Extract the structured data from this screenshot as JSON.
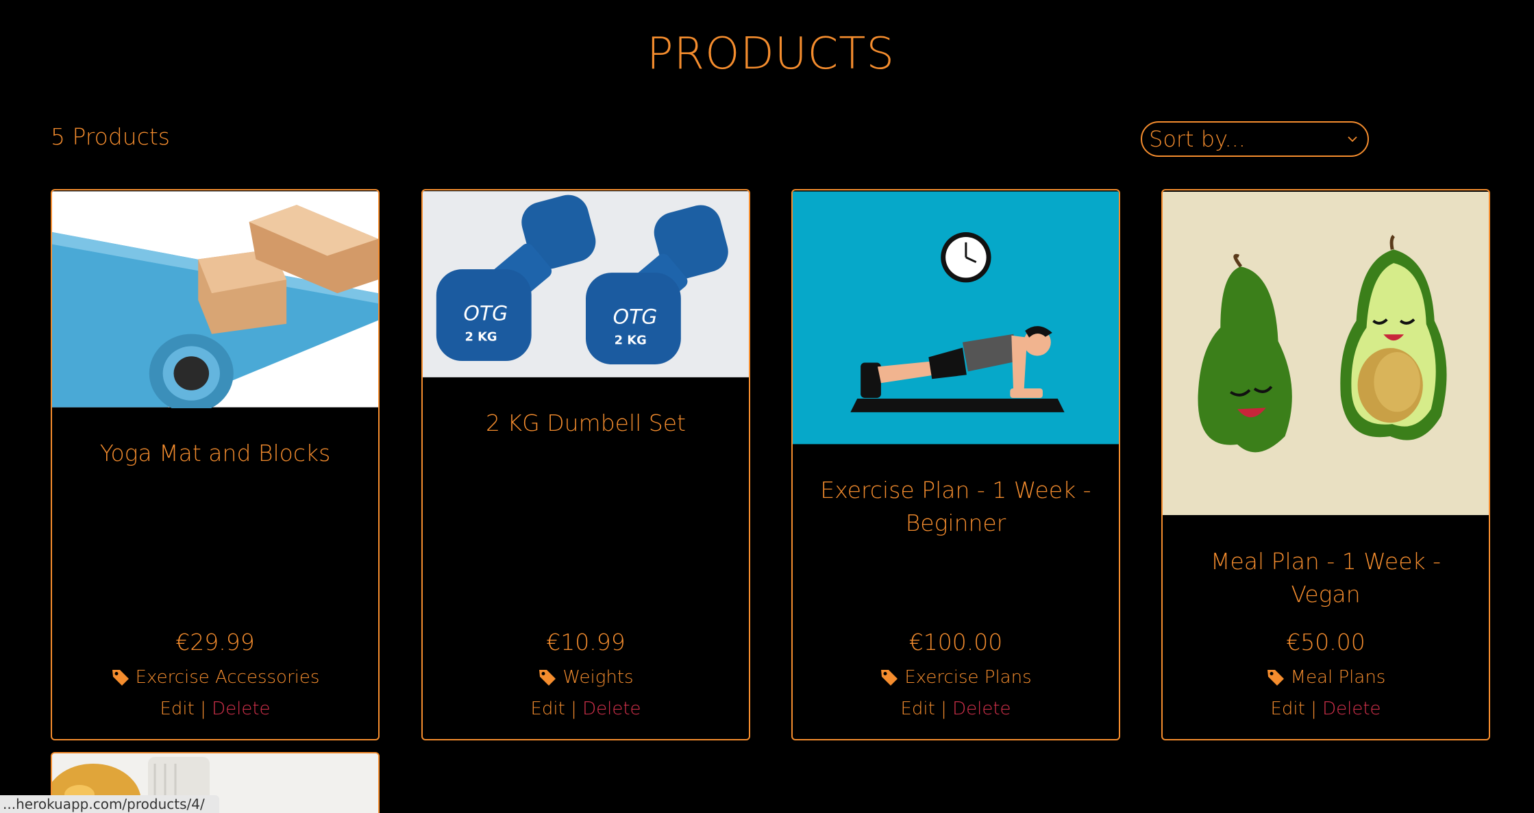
{
  "page": {
    "title": "PRODUCTS"
  },
  "toolbar": {
    "count_label": "5 Products",
    "sort_label": "Sort by..."
  },
  "products": [
    {
      "name": "Yoga Mat and Blocks",
      "price": "€29.99",
      "category": "Exercise Accessories",
      "edit": "Edit",
      "sep": "|",
      "delete": "Delete"
    },
    {
      "name": "2 KG Dumbell Set",
      "price": "€10.99",
      "category": "Weights",
      "edit": "Edit",
      "sep": "|",
      "delete": "Delete"
    },
    {
      "name": "Exercise Plan - 1 Week - Beginner",
      "price": "€100.00",
      "category": "Exercise Plans",
      "edit": "Edit",
      "sep": "|",
      "delete": "Delete"
    },
    {
      "name": "Meal Plan - 1 Week - Vegan",
      "price": "€50.00",
      "category": "Meal Plans",
      "edit": "Edit",
      "sep": "|",
      "delete": "Delete"
    }
  ],
  "status_bar": {
    "url": "...herokuapp.com/products/4/"
  },
  "colors": {
    "accent": "#f58d2e",
    "delete": "#d8324d",
    "background": "#000000"
  }
}
